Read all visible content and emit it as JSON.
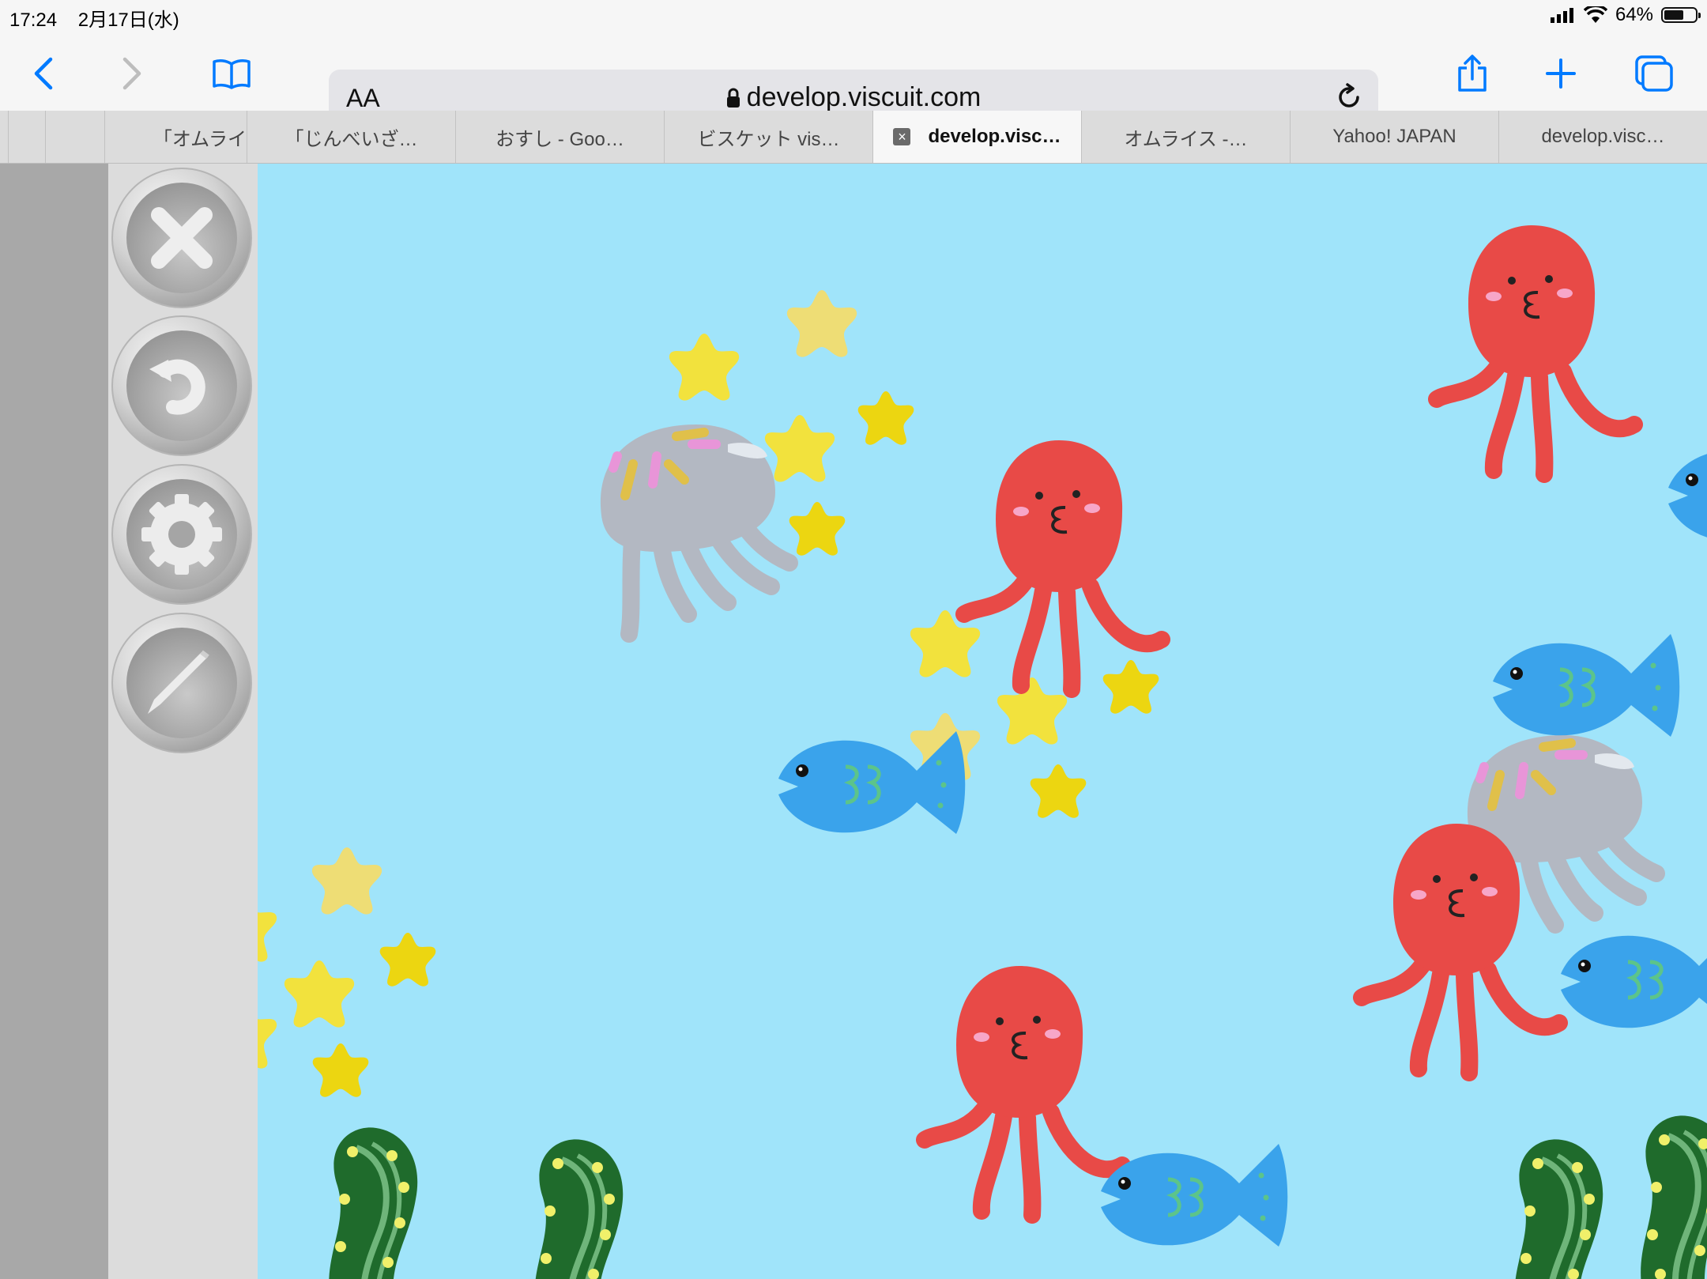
{
  "status": {
    "time": "17:24",
    "date": "2月17日(水)",
    "battery_percent": "64%",
    "battery_level": 0.64
  },
  "browser": {
    "text_size_label": "AA",
    "address": "develop.viscuit.com"
  },
  "tabs": [
    {
      "label": "「オムライ"
    },
    {
      "label": "「じんべいざ…"
    },
    {
      "label": "おすし - Goo…"
    },
    {
      "label": "ビスケット vis…"
    },
    {
      "label": "develop.visc…",
      "active": true
    },
    {
      "label": "オムライス -…"
    },
    {
      "label": "Yahoo! JAPAN"
    },
    {
      "label": "develop.visc…"
    }
  ],
  "tools": [
    {
      "name": "close-icon"
    },
    {
      "name": "undo-icon"
    },
    {
      "name": "settings-gear-icon"
    },
    {
      "name": "pencil-icon"
    }
  ],
  "canvas": {
    "background": "#a0e4fa"
  },
  "colors": {
    "accent": "#007aff",
    "octopus": "#e84a47",
    "fish": "#3aa3eb",
    "star": "#f2e23d",
    "jellyfish": "#b3b8c2",
    "seaweed": "#1f6b2c"
  }
}
